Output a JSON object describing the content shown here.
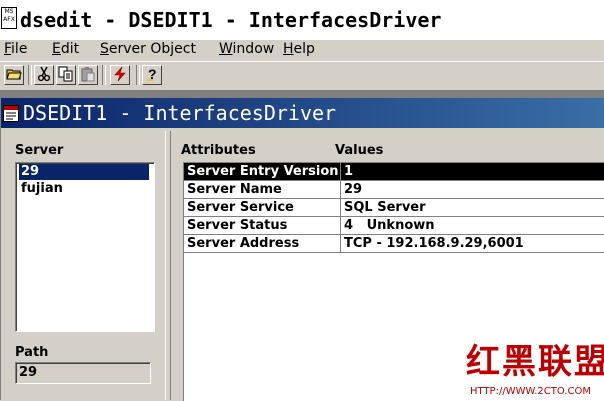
{
  "app": {
    "title": "dsedit - DSEDIT1 - InterfacesDriver",
    "icon_text": "MS AFX"
  },
  "menu": {
    "items": [
      {
        "label": "File"
      },
      {
        "label": "Edit"
      },
      {
        "label": "Server Object"
      },
      {
        "label": "Window"
      },
      {
        "label": "Help"
      }
    ]
  },
  "toolbar": {
    "buttons": [
      {
        "icon": "open-folder-icon"
      },
      {
        "icon": "cut-icon"
      },
      {
        "icon": "copy-icon"
      },
      {
        "icon": "paste-icon"
      },
      {
        "icon": "ping-lightning-icon"
      },
      {
        "icon": "help-icon"
      }
    ]
  },
  "child_window": {
    "title": "DSEDIT1 - InterfacesDriver"
  },
  "server_pane": {
    "label": "Server",
    "items": [
      {
        "label": "29",
        "selected": true
      },
      {
        "label": "fujian",
        "selected": false
      }
    ]
  },
  "path": {
    "label": "Path",
    "value": "29"
  },
  "attributes": {
    "col_attributes": "Attributes",
    "col_values": "Values",
    "rows": [
      {
        "attribute": "Server Entry Version",
        "value": "1",
        "selected": true
      },
      {
        "attribute": "Server Name",
        "value": "29",
        "selected": false
      },
      {
        "attribute": "Server Service",
        "value": "SQL Server",
        "selected": false
      },
      {
        "attribute": "Server Status",
        "value": "4   Unknown",
        "selected": false
      },
      {
        "attribute": "Server Address",
        "value": "TCP - 192.168.9.29,6001",
        "selected": false
      }
    ]
  },
  "watermark": {
    "text": "红黑联盟",
    "url": "HTTP://WWW.2CTO.COM"
  },
  "colors": {
    "selection": "#0a246a",
    "grid_selection": "#000000",
    "watermark": "#c00000"
  }
}
